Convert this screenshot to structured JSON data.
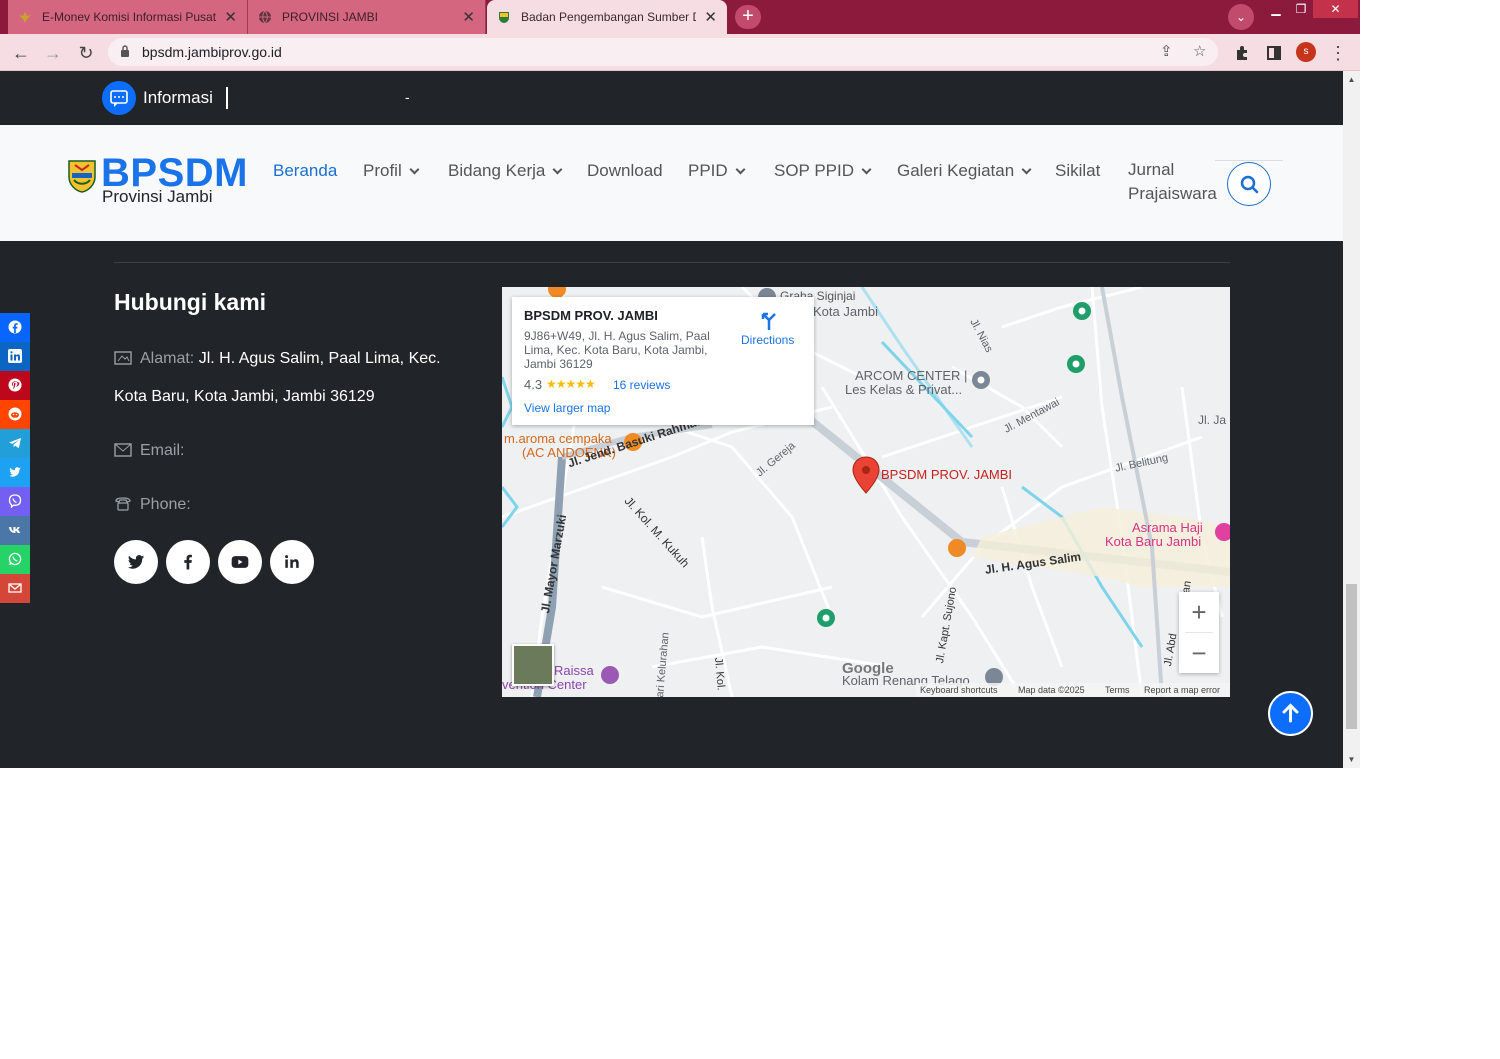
{
  "browser": {
    "tabs": [
      {
        "title": "E-Monev Komisi Informasi Pusat",
        "active": false
      },
      {
        "title": "PROVINSI JAMBI",
        "active": false
      },
      {
        "title": "Badan Pengembangan Sumber Daya",
        "active": true
      }
    ],
    "url": "bpsdm.jambiprov.go.id",
    "profile_initial": "s",
    "icons": [
      "back-icon",
      "forward-icon",
      "reload-icon",
      "lock-icon",
      "share-icon",
      "star-icon",
      "extensions-icon",
      "side-panel-icon",
      "kebab-menu-icon"
    ]
  },
  "ticker": {
    "label": "Informasi",
    "text": "-"
  },
  "site": {
    "logo_title": "BPSDM",
    "logo_subtitle": "Provinsi Jambi",
    "nav": [
      {
        "label": "Beranda",
        "dropdown": false,
        "active": true
      },
      {
        "label": "Profil",
        "dropdown": true
      },
      {
        "label": "Bidang Kerja",
        "dropdown": true
      },
      {
        "label": "Download",
        "dropdown": false
      },
      {
        "label": "PPID",
        "dropdown": true
      },
      {
        "label": "SOP PPID",
        "dropdown": true
      },
      {
        "label": "Galeri Kegiatan",
        "dropdown": true
      },
      {
        "label": "Sikilat",
        "dropdown": false
      },
      {
        "label": "Jurnal",
        "dropdown": false
      },
      {
        "label": "Prajaiswara",
        "dropdown": false
      }
    ]
  },
  "contact": {
    "title": "Hubungi kami",
    "address_label": "Alamat:",
    "address_line1": "Jl. H. Agus Salim, Paal Lima, Kec.",
    "address_line2": "Kota Baru, Kota Jambi, Jambi 36129",
    "email_label": "Email:",
    "phone_label": "Phone:",
    "socials": [
      "twitter-icon",
      "facebook-icon",
      "youtube-icon",
      "linkedin-icon"
    ]
  },
  "share_sidebar": [
    {
      "icon": "facebook-icon",
      "color": "#0866ff"
    },
    {
      "icon": "linkedin-icon",
      "color": "#0a66c2"
    },
    {
      "icon": "pinterest-icon",
      "color": "#bd081c"
    },
    {
      "icon": "reddit-icon",
      "color": "#ff4500"
    },
    {
      "icon": "telegram-icon",
      "color": "#229ed9"
    },
    {
      "icon": "twitter-icon",
      "color": "#1da1f2"
    },
    {
      "icon": "viber-icon",
      "color": "#7360f2"
    },
    {
      "icon": "vk-icon",
      "color": "#4a76a8"
    },
    {
      "icon": "whatsapp-icon",
      "color": "#25d366"
    },
    {
      "icon": "gmail-icon",
      "color": "#d44638"
    }
  ],
  "map": {
    "place_name": "BPSDM PROV. JAMBI",
    "place_address": "9J86+W49, Jl. H. Agus Salim, Paal Lima, Kec. Kota Baru, Kota Jambi, Jambi 36129",
    "rating": "4.3",
    "stars": "★★★★★",
    "reviews": "16 reviews",
    "view_larger": "View larger map",
    "directions": "Directions",
    "marker_label": "BPSDM PROV. JAMBI",
    "labels": {
      "graha": "Graha Siginjai",
      "kota_jambi": "Kota Jambi",
      "arcom1": "ARCOM CENTER |",
      "arcom2": "Les Kelas & Privat...",
      "aroma1": "m.aroma cempaka",
      "aroma2": "(AC ANDOENK)",
      "basuki": "Jl. Jend. Basuki Rahmat",
      "kukuh": "Jl. Kol. M. Kukuh",
      "marzuki": "Jl. Mayor Marzuki",
      "gereja": "Jl. Gereja",
      "mentawai": "Jl. Mentawai",
      "nias": "Jl. Nias",
      "belitung": "Jl. Belitung",
      "ja": "Jl. Ja",
      "agus": "Jl. H. Agus Salim",
      "asrama1": "Asrama Haji",
      "asrama2": "Kota Baru Jambi",
      "sujono": "Jl. Kapt. Sujono",
      "kelurahan": "ari Kelurahan",
      "kol": "Jl. Kol.",
      "abd": "Jl. Abd",
      "an": "an",
      "raissa1": "Raissa",
      "raissa2": "vention Center",
      "kolam": "Kolam Renang Telago",
      "google": "Google"
    },
    "footer": {
      "shortcuts": "Keyboard shortcuts",
      "mapdata": "Map data ©2025",
      "terms": "Terms",
      "report": "Report a map error"
    }
  }
}
